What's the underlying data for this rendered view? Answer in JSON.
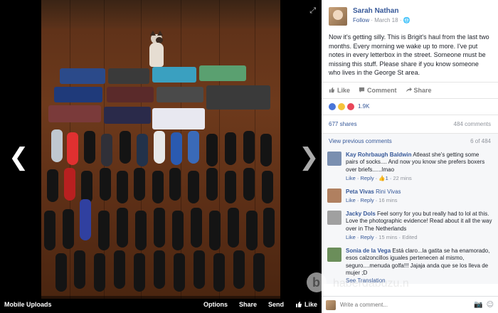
{
  "viewer": {
    "album": "Mobile Uploads",
    "options": "Options",
    "share": "Share",
    "send": "Send",
    "like": "Like",
    "prev_icon": "chevron-left-icon",
    "next_icon": "chevron-right-icon",
    "expand_icon": "expand-icon"
  },
  "post": {
    "author": "Sarah Nathan",
    "follow": "Follow",
    "date": "March 18",
    "text": "Now it's getting silly. This is Brigit's haul from the last two months. Every morning we wake up to more. I've put notes in every letterbox in the street. Someone must be missing this stuff. Please share if you know someone who lives in the George St area.",
    "actions": {
      "like": "Like",
      "comment": "Comment",
      "share": "Share"
    },
    "reaction_count": "1.9K",
    "shares": "677 shares",
    "comments_count": "484 comments",
    "view_previous": "View previous comments",
    "paging": "6 of 484"
  },
  "comments": [
    {
      "name": "Kay Rohrbaugh Baldwin",
      "text": "Atleast she's getting some pairs of socks.... And now you know she prefers boxers over briefs......lmao",
      "like": "Like",
      "reply": "Reply",
      "likes": "1",
      "time": "22 mins",
      "color": "#7a8fb0"
    },
    {
      "name": "Peta Vivas",
      "text": "Rini Vivas",
      "like": "Like",
      "reply": "Reply",
      "time": "16 mins",
      "color": "#b08060"
    },
    {
      "name": "Jacky Dols",
      "text": "Feel sorry for you but really had to lol at this. Love the photographic evidence! Read about it all the way over in The Netherlands",
      "like": "Like",
      "reply": "Reply",
      "time": "15 mins",
      "edited": "Edited",
      "color": "#a0a0a0"
    },
    {
      "name": "Sonia de la Vega",
      "text": "Está claro...la gatita se ha enamorado, esos calzoncillos iguales pertenecen al mismo, seguro....menuda golfa!!! Jajaja anda que se los lleva de mujer ;D",
      "see_translation": "See Translation",
      "color": "#6b8e5a"
    }
  ],
  "write": {
    "placeholder": "Write a comment..."
  }
}
